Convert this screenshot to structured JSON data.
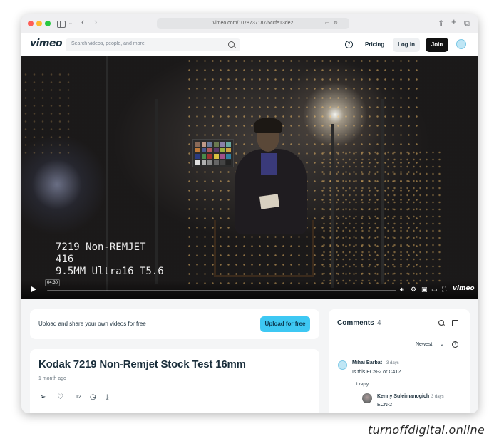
{
  "browser": {
    "url": "vimeo.com/1078737187/5ccfe13de2"
  },
  "header": {
    "logo": "vimeo",
    "search_placeholder": "Search videos, people, and more",
    "help_label": "?",
    "pricing_label": "Pricing",
    "login_label": "Log in",
    "join_label": "Join"
  },
  "player": {
    "overlay_lines": [
      "7219 Non-REMJET",
      "416",
      "9.5MM Ultra16 T5.6"
    ],
    "timecode": "04:30",
    "progress": 0.0,
    "brand": "vimeo"
  },
  "upload": {
    "text": "Upload and share your own videos for free",
    "button_label": "Upload for free"
  },
  "video": {
    "title": "Kodak 7219 Non-Remjet Stock Test 16mm",
    "date": "1 month ago",
    "likes": "12"
  },
  "comments": {
    "title": "Comments",
    "count": "4",
    "sort_label": "Newest",
    "items": [
      {
        "author": "Mihai Barbat",
        "time": "3 days",
        "text": "Is this ECN-2 or C41?",
        "reply_label": "1 reply"
      },
      {
        "author": "Kenny Suleimanogich",
        "time": "3 days",
        "text": "ECN-2"
      }
    ]
  },
  "colors": {
    "accent": "#3ec8f3",
    "join_bg": "#111111",
    "text": "#1a2e3b"
  },
  "watermark": "turnoffdigital.online"
}
